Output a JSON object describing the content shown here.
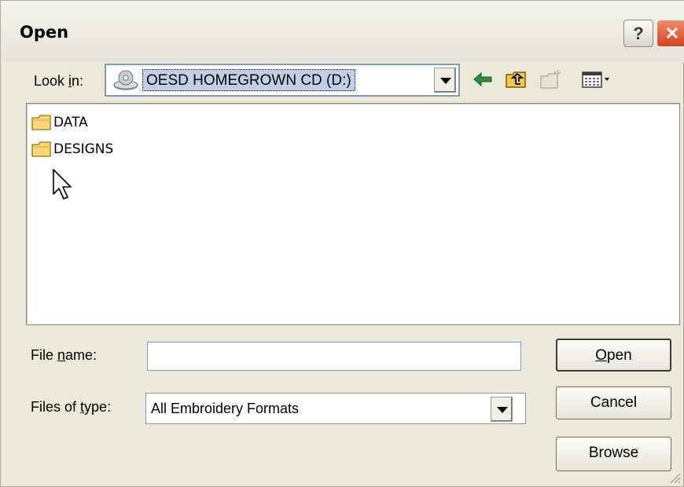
{
  "window": {
    "title": "Open",
    "help_glyph": "?",
    "close_glyph": "✕"
  },
  "lookin": {
    "label_pre": "Look ",
    "label_access": "i",
    "label_post": "n:",
    "value": "OESD HOMEGROWN CD (D:)",
    "icon": "cd-drive-icon"
  },
  "toolbar": {
    "icons": [
      "back-arrow-icon",
      "up-one-level-icon",
      "create-new-folder-icon",
      "view-menu-icon"
    ]
  },
  "files": [
    {
      "name": "DATA",
      "icon": "folder-icon"
    },
    {
      "name": "DESIGNS",
      "icon": "folder-icon"
    }
  ],
  "file_name": {
    "label_pre": "File ",
    "label_access": "n",
    "label_post": "ame:",
    "value": "",
    "placeholder": ""
  },
  "file_type": {
    "label_pre": "Files of ",
    "label_access": "t",
    "label_post": "ype:",
    "value": "All Embroidery Formats"
  },
  "buttons": {
    "open_access": "O",
    "open_rest": "pen",
    "cancel": "Cancel",
    "browse": "Browse"
  },
  "colors": {
    "dialog_bg": "#ece9d8",
    "selection": "#c1cfe6",
    "close_red": "#d2431c",
    "folder_yellow": "#f2c94c"
  }
}
